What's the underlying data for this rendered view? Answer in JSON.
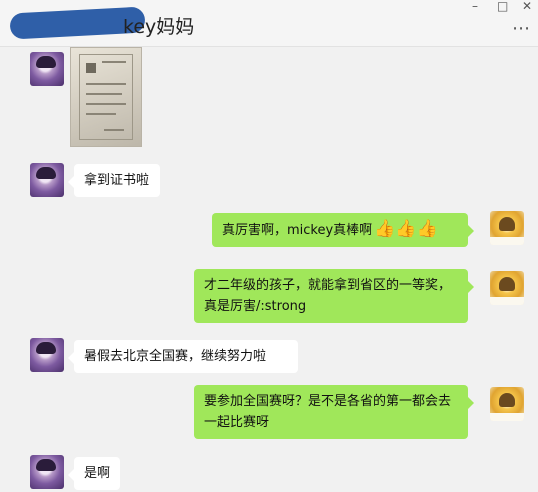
{
  "window": {
    "title_suffix": "key妈妈",
    "more_icon": "⋯"
  },
  "messages": [
    {
      "side": "left",
      "type": "image",
      "content_kind": "certificate-photo"
    },
    {
      "side": "left",
      "type": "text",
      "text": "拿到证书啦"
    },
    {
      "side": "right",
      "type": "text",
      "text": "真厉害啊，mickey真棒啊",
      "suffix": "👍👍👍"
    },
    {
      "side": "right",
      "type": "text",
      "text": "才二年级的孩子，就能拿到省区的一等奖，真是厉害/:strong"
    },
    {
      "side": "left",
      "type": "text",
      "text": "暑假去北京全国赛，继续努力啦"
    },
    {
      "side": "right",
      "type": "text",
      "text": "要参加全国赛呀？是不是各省的第一都会去一起比赛呀"
    },
    {
      "side": "left",
      "type": "text",
      "text": "是啊"
    }
  ],
  "colors": {
    "chat_background": "#f1f1f1",
    "sent_bubble": "#a0e75a",
    "received_bubble": "#ffffff"
  }
}
